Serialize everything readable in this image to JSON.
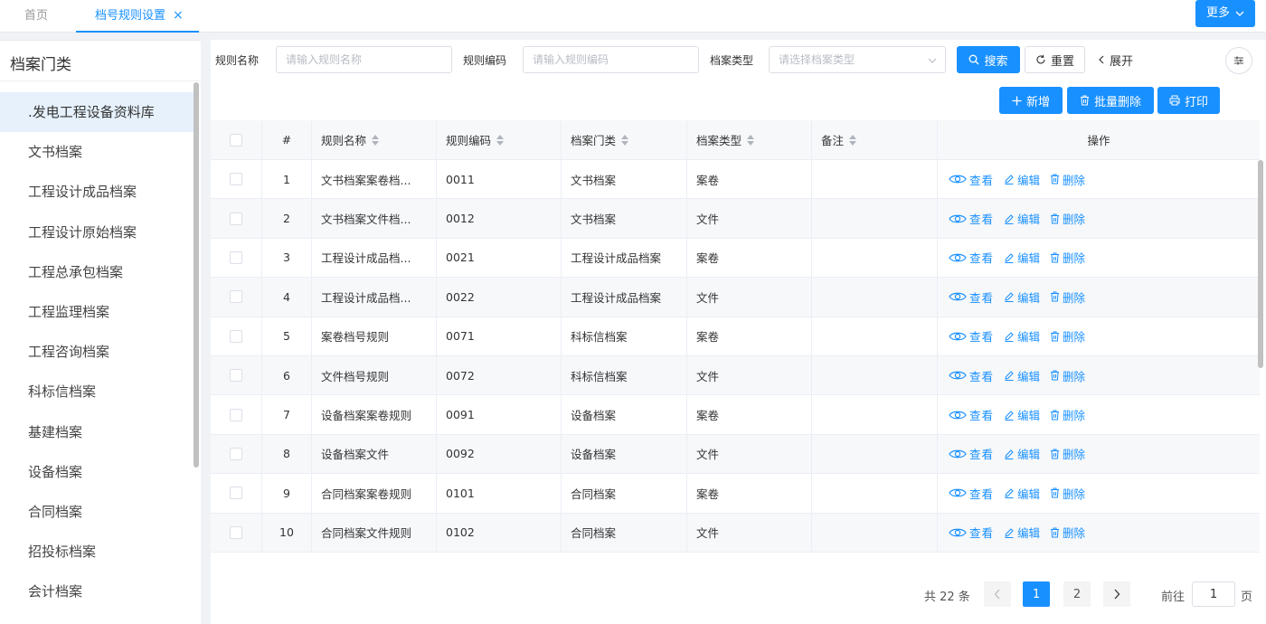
{
  "tabs": {
    "home": "首页",
    "active": "档号规则设置",
    "close": "×",
    "more": "更多"
  },
  "sidebar": {
    "title": "档案门类",
    "items": [
      {
        "label": ".发电工程设备资料库",
        "active": true
      },
      {
        "label": "文书档案"
      },
      {
        "label": "工程设计成品档案"
      },
      {
        "label": "工程设计原始档案"
      },
      {
        "label": "工程总承包档案"
      },
      {
        "label": "工程监理档案"
      },
      {
        "label": "工程咨询档案"
      },
      {
        "label": "科标信档案"
      },
      {
        "label": "基建档案"
      },
      {
        "label": "设备档案"
      },
      {
        "label": "合同档案"
      },
      {
        "label": "招投标档案"
      },
      {
        "label": "会计档案"
      }
    ]
  },
  "filters": {
    "name_label": "规则名称",
    "name_placeholder": "请输入规则名称",
    "code_label": "规则编码",
    "code_placeholder": "请输入规则编码",
    "type_label": "档案类型",
    "type_placeholder": "请选择档案类型",
    "search": "搜索",
    "reset": "重置",
    "expand": "展开"
  },
  "actions": {
    "add": "新增",
    "batch_delete": "批量删除",
    "print": "打印"
  },
  "table": {
    "headers": {
      "index": "#",
      "name": "规则名称",
      "code": "规则编码",
      "category": "档案门类",
      "type": "档案类型",
      "note": "备注",
      "ops": "操作"
    },
    "op_labels": {
      "view": "查看",
      "edit": "编辑",
      "delete": "删除"
    },
    "rows": [
      {
        "idx": "1",
        "name": "文书档案案卷档...",
        "code": "0011",
        "category": "文书档案",
        "type": "案卷",
        "note": ""
      },
      {
        "idx": "2",
        "name": "文书档案文件档...",
        "code": "0012",
        "category": "文书档案",
        "type": "文件",
        "note": ""
      },
      {
        "idx": "3",
        "name": "工程设计成品档...",
        "code": "0021",
        "category": "工程设计成品档案",
        "type": "案卷",
        "note": ""
      },
      {
        "idx": "4",
        "name": "工程设计成品档...",
        "code": "0022",
        "category": "工程设计成品档案",
        "type": "文件",
        "note": ""
      },
      {
        "idx": "5",
        "name": "案卷档号规则",
        "code": "0071",
        "category": "科标信档案",
        "type": "案卷",
        "note": ""
      },
      {
        "idx": "6",
        "name": "文件档号规则",
        "code": "0072",
        "category": "科标信档案",
        "type": "文件",
        "note": ""
      },
      {
        "idx": "7",
        "name": "设备档案案卷规则",
        "code": "0091",
        "category": "设备档案",
        "type": "案卷",
        "note": ""
      },
      {
        "idx": "8",
        "name": "设备档案文件",
        "code": "0092",
        "category": "设备档案",
        "type": "文件",
        "note": ""
      },
      {
        "idx": "9",
        "name": "合同档案案卷规则",
        "code": "0101",
        "category": "合同档案",
        "type": "案卷",
        "note": ""
      },
      {
        "idx": "10",
        "name": "合同档案文件规则",
        "code": "0102",
        "category": "合同档案",
        "type": "文件",
        "note": ""
      }
    ]
  },
  "pagination": {
    "total": "共 22 条",
    "pages": [
      "1",
      "2"
    ],
    "current": "1",
    "goto_label": "前往",
    "goto_value": "1",
    "goto_suffix": "页"
  },
  "colors": {
    "accent": "#1890ff",
    "active_bg": "#e6f1fc"
  }
}
